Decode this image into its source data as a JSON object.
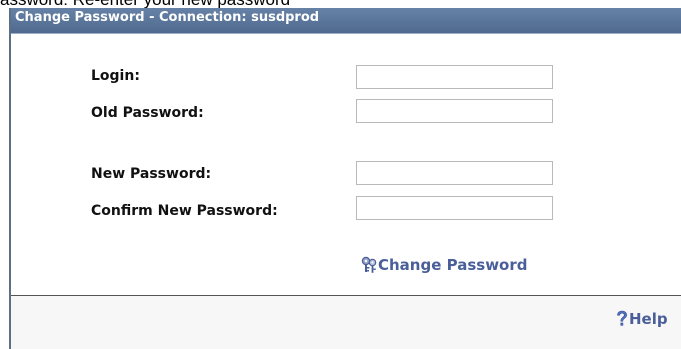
{
  "page_caption": "assword: Re-enter your new password",
  "dialog": {
    "title": "Change Password - Connection: susdprod",
    "fields": {
      "login_label": "Login:",
      "old_password_label": "Old Password:",
      "new_password_label": "New Password:",
      "confirm_password_label": "Confirm New Password:",
      "login_value": "",
      "old_password_value": "",
      "new_password_value": "",
      "confirm_password_value": ""
    },
    "change_password_button": {
      "label": "Change Password",
      "icon": "keys-icon"
    },
    "help_link": {
      "label": "Help",
      "icon": "question-mark-icon"
    }
  },
  "colors": {
    "titlebar": "#4f6a8e",
    "link": "#4a5f9a"
  }
}
